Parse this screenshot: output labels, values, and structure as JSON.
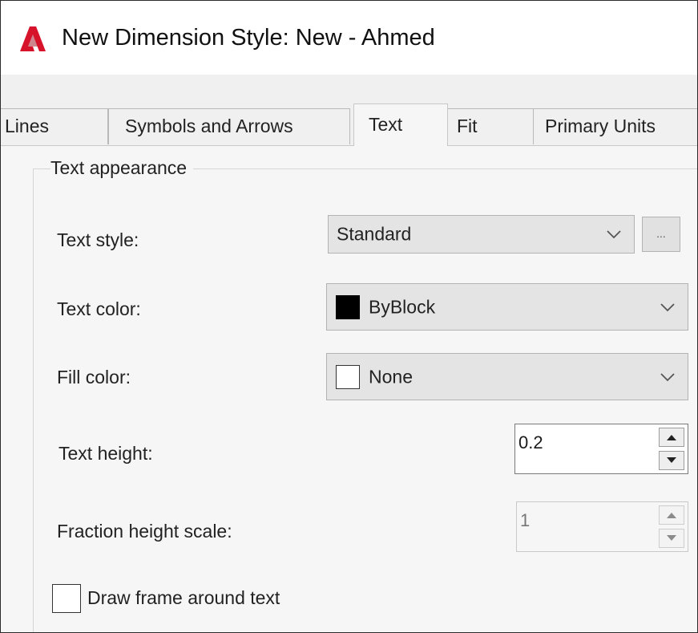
{
  "window": {
    "title": "New Dimension Style: New - Ahmed",
    "app_icon": "autocad-logo-icon",
    "accent_color": "#c8102e"
  },
  "tabs": [
    {
      "label": "Lines",
      "active": false
    },
    {
      "label": "Symbols and Arrows",
      "active": false
    },
    {
      "label": "Text",
      "active": true
    },
    {
      "label": "Fit",
      "active": false
    },
    {
      "label": "Primary Units",
      "active": false
    }
  ],
  "text_appearance": {
    "group_label": "Text appearance",
    "text_style": {
      "label": "Text style:",
      "value": "Standard",
      "browse_label": "..."
    },
    "text_color": {
      "label": "Text color:",
      "value": "ByBlock",
      "swatch_color": "#000000"
    },
    "fill_color": {
      "label": "Fill color:",
      "value": "None",
      "swatch_color": "#ffffff"
    },
    "text_height": {
      "label": "Text height:",
      "value": "0.2"
    },
    "fraction_height_scale": {
      "label": "Fraction height scale:",
      "value": "1",
      "enabled": false
    },
    "draw_frame": {
      "label": "Draw frame around text",
      "checked": false
    }
  }
}
